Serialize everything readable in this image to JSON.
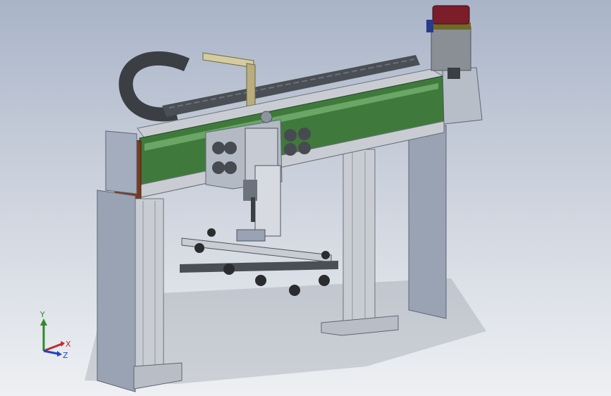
{
  "viewport": {
    "background_top": "#a9b4c8",
    "background_bottom": "#eef0f3"
  },
  "model": {
    "colors": {
      "beam_green": "#3f7a3c",
      "beam_green_dark": "#2c5a2b",
      "aluminum": "#c9cdd3",
      "aluminum_dark": "#8e949d",
      "leg_plate": "#9aa3b3",
      "leg_plate_dark": "#7d8696",
      "end_cap": "#7a3a1f",
      "motor_body": "#8a8f96",
      "motor_cap": "#7b1e2a",
      "motor_band": "#6f6a2a",
      "bracket_tan": "#b7ad7e",
      "cable_chain": "#3b3f44",
      "suction_cup": "#2a2c2f"
    }
  },
  "triad": {
    "y_label": "Y",
    "x_label": "X",
    "z_label": "Z",
    "y_color": "#2e8b2e",
    "x_color": "#c0282d",
    "z_color": "#1d46c4"
  }
}
